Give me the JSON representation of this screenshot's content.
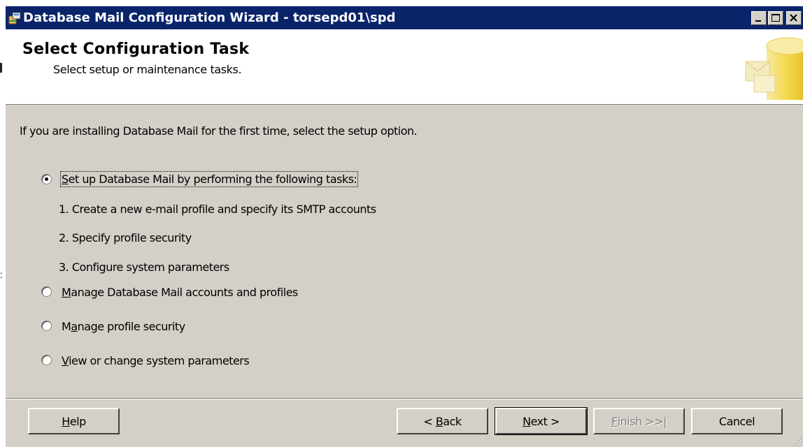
{
  "window": {
    "title": "Database Mail Configuration Wizard - torsepd01\\spd"
  },
  "header": {
    "title": "Select Configuration Task",
    "subtitle": "Select setup or maintenance tasks."
  },
  "main": {
    "intro": "If you are installing Database Mail for the first time, select the setup option.",
    "options": [
      {
        "pre": "",
        "accel": "S",
        "post": "et up Database Mail by performing the following tasks:",
        "selected": true
      },
      {
        "pre": "",
        "accel": "M",
        "post": "anage Database Mail accounts and profiles",
        "selected": false
      },
      {
        "pre": "M",
        "accel": "a",
        "post": "nage profile security",
        "selected": false
      },
      {
        "pre": "",
        "accel": "V",
        "post": "iew or change system parameters",
        "selected": false
      }
    ],
    "setup_steps": [
      "1. Create a new e-mail profile and specify its SMTP accounts",
      "2. Specify profile security",
      "3. Configure system parameters"
    ]
  },
  "footer": {
    "help": {
      "accel": "H",
      "post": "elp"
    },
    "back": {
      "pre": "< ",
      "accel": "B",
      "post": "ack"
    },
    "next": {
      "pre": "",
      "accel": "N",
      "post": "ext >"
    },
    "finish": {
      "pre": "",
      "accel": "F",
      "post": "inish >>|",
      "disabled": true
    },
    "cancel": "Cancel"
  },
  "colors": {
    "titlebar": "#0a246a",
    "dialog_bg": "#d4d0c8",
    "header_bg": "#ffffff"
  },
  "icons": {
    "app": "wizard-app-icon",
    "header": "database-icon"
  }
}
